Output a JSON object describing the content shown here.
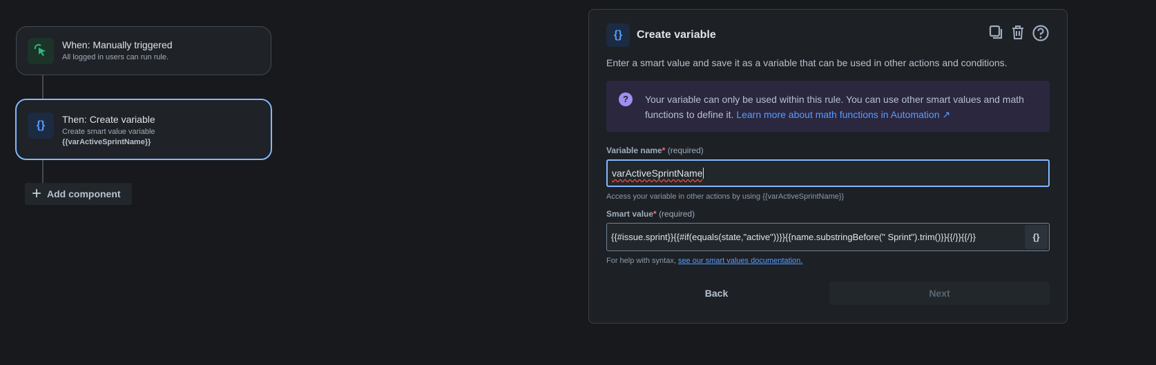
{
  "flow": {
    "trigger": {
      "title": "When: Manually triggered",
      "subtitle": "All logged in users can run rule."
    },
    "action": {
      "title": "Then: Create variable",
      "subtitle": "Create smart value variable",
      "detail": "{{varActiveSprintName}}"
    },
    "add_label": "Add component"
  },
  "panel": {
    "icon": "{}",
    "title": "Create variable",
    "description": "Enter a smart value and save it as a variable that can be used in other actions and conditions.",
    "info_text": "Your variable can only be used within this rule. You can use other smart values and math functions to define it. ",
    "info_link": "Learn more about math functions in Automation ↗",
    "var_label": "Variable name",
    "required_star": "*",
    "required_text": "(required)",
    "var_value": "varActiveSprintName",
    "var_help": "Access your variable in other actions by using {{varActiveSprintName}}",
    "smart_label": "Smart value",
    "smart_value": "{{#issue.sprint}}{{#if(equals(state,\"active\"))}}{{name.substringBefore(\" Sprint\").trim()}}{{/}}{{/}}",
    "smart_button": "{}",
    "syntax_help": "For help with syntax, ",
    "syntax_link": "see our smart values documentation.",
    "back_label": "Back",
    "next_label": "Next"
  }
}
